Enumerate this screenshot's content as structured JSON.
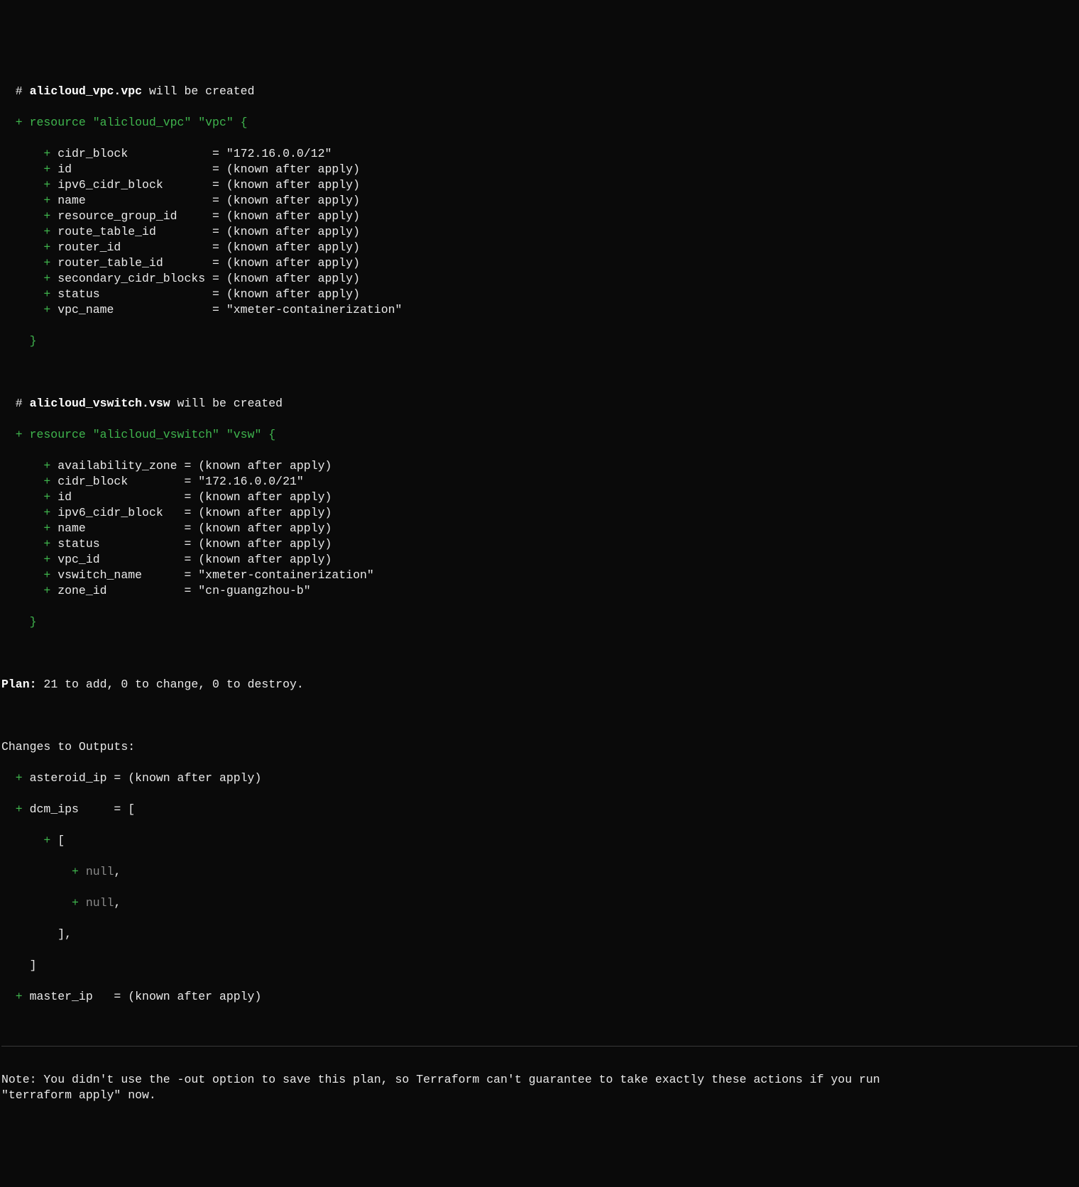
{
  "vpc": {
    "header_hash": "  # ",
    "header_res_name": "alicloud_vpc.vpc",
    "header_rest": " will be created",
    "resource_line": "  + resource \"alicloud_vpc\" \"vpc\" {",
    "attrs": [
      {
        "key": "cidr_block",
        "value": "\"172.16.0.0/12\""
      },
      {
        "key": "id",
        "value": "(known after apply)"
      },
      {
        "key": "ipv6_cidr_block",
        "value": "(known after apply)"
      },
      {
        "key": "name",
        "value": "(known after apply)"
      },
      {
        "key": "resource_group_id",
        "value": "(known after apply)"
      },
      {
        "key": "route_table_id",
        "value": "(known after apply)"
      },
      {
        "key": "router_id",
        "value": "(known after apply)"
      },
      {
        "key": "router_table_id",
        "value": "(known after apply)"
      },
      {
        "key": "secondary_cidr_blocks",
        "value": "(known after apply)"
      },
      {
        "key": "status",
        "value": "(known after apply)"
      },
      {
        "key": "vpc_name",
        "value": "\"xmeter-containerization\""
      }
    ],
    "close": "    }",
    "key_width": 21
  },
  "vsw": {
    "header_hash": "  # ",
    "header_res_name": "alicloud_vswitch.vsw",
    "header_rest": " will be created",
    "resource_line": "  + resource \"alicloud_vswitch\" \"vsw\" {",
    "attrs": [
      {
        "key": "availability_zone",
        "value": "(known after apply)"
      },
      {
        "key": "cidr_block",
        "value": "\"172.16.0.0/21\""
      },
      {
        "key": "id",
        "value": "(known after apply)"
      },
      {
        "key": "ipv6_cidr_block",
        "value": "(known after apply)"
      },
      {
        "key": "name",
        "value": "(known after apply)"
      },
      {
        "key": "status",
        "value": "(known after apply)"
      },
      {
        "key": "vpc_id",
        "value": "(known after apply)"
      },
      {
        "key": "vswitch_name",
        "value": "\"xmeter-containerization\""
      },
      {
        "key": "zone_id",
        "value": "\"cn-guangzhou-b\""
      }
    ],
    "close": "    }",
    "key_width": 17
  },
  "plan": {
    "label": "Plan:",
    "rest": " 21 to add, 0 to change, 0 to destroy."
  },
  "outputs": {
    "header": "Changes to Outputs:",
    "items": [
      {
        "key": "asteroid_ip",
        "value": "(known after apply)"
      },
      {
        "key": "dcm_ips",
        "value": "["
      },
      {
        "key": "master_ip",
        "value": "(known after apply)"
      }
    ],
    "dcm_inner_open": "      + [",
    "dcm_null": "          + null,",
    "dcm_null2": "          + null,",
    "dcm_inner_close": "        ],",
    "dcm_close": "    ]",
    "key_width": 11
  },
  "note": "Note: You didn't use the -out option to save this plan, so Terraform can't guarantee to take exactly these actions if you run\n\"terraform apply\" now."
}
